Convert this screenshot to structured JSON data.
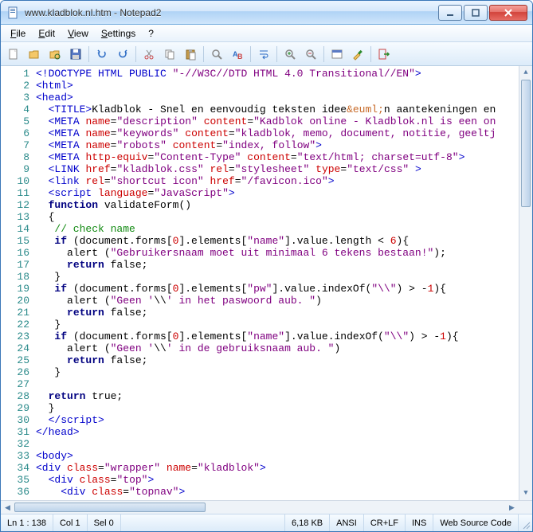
{
  "window": {
    "title": "www.kladblok.nl.htm - Notepad2"
  },
  "menu": {
    "file": "File",
    "edit": "Edit",
    "view": "View",
    "settings": "Settings",
    "help": "?"
  },
  "toolbar": {
    "new": "New",
    "open": "Open",
    "browse": "Browse",
    "save": "Save",
    "undo": "Undo",
    "redo": "Redo",
    "cut": "Cut",
    "copy": "Copy",
    "paste": "Paste",
    "find": "Find",
    "replace": "Replace",
    "wordwrap": "Word Wrap",
    "zoomin": "Zoom In",
    "zoomout": "Zoom Out",
    "scheme": "Scheme",
    "custom": "Customize",
    "exit": "Exit"
  },
  "code_lines": [
    {
      "n": 1,
      "html": "<span class='c-blue'>&lt;!DOCTYPE HTML PUBLIC </span><span class='c-purple'>\"-//W3C//DTD HTML 4.0 Transitional//EN\"</span><span class='c-blue'>&gt;</span>"
    },
    {
      "n": 2,
      "html": "<span class='c-blue'>&lt;html&gt;</span>"
    },
    {
      "n": 3,
      "html": "<span class='c-blue'>&lt;head&gt;</span>"
    },
    {
      "n": 4,
      "html": "  <span class='c-blue'>&lt;TITLE&gt;</span>Kladblok - Snel en eenvoudig teksten idee<span class='c-ent'>&amp;euml;</span>n aantekeningen en"
    },
    {
      "n": 5,
      "html": "  <span class='c-blue'>&lt;META</span> <span class='c-red'>name</span>=<span class='c-purple'>\"description\"</span> <span class='c-red'>content</span>=<span class='c-purple'>\"Kadblok online - Kladblok.nl is een on</span>"
    },
    {
      "n": 6,
      "html": "  <span class='c-blue'>&lt;META</span> <span class='c-red'>name</span>=<span class='c-purple'>\"keywords\"</span> <span class='c-red'>content</span>=<span class='c-purple'>\"kladblok, memo, document, notitie, geeltj</span>"
    },
    {
      "n": 7,
      "html": "  <span class='c-blue'>&lt;META</span> <span class='c-red'>name</span>=<span class='c-purple'>\"robots\"</span> <span class='c-red'>content</span>=<span class='c-purple'>\"index, follow\"</span><span class='c-blue'>&gt;</span>"
    },
    {
      "n": 8,
      "html": "  <span class='c-blue'>&lt;META</span> <span class='c-red'>http-equiv</span>=<span class='c-purple'>\"Content-Type\"</span> <span class='c-red'>content</span>=<span class='c-purple'>\"text/html; charset=utf-8\"</span><span class='c-blue'>&gt;</span>"
    },
    {
      "n": 9,
      "html": "  <span class='c-blue'>&lt;LINK</span> <span class='c-red'>href</span>=<span class='c-purple'>\"kladblok.css\"</span> <span class='c-red'>rel</span>=<span class='c-purple'>\"stylesheet\"</span> <span class='c-red'>type</span>=<span class='c-purple'>\"text/css\"</span> <span class='c-blue'>&gt;</span>"
    },
    {
      "n": 10,
      "html": "  <span class='c-blue'>&lt;link</span> <span class='c-red'>rel</span>=<span class='c-purple'>\"shortcut icon\"</span> <span class='c-red'>href</span>=<span class='c-purple'>\"/favicon.ico\"</span><span class='c-blue'>&gt;</span>"
    },
    {
      "n": 11,
      "html": "  <span class='c-blue'>&lt;script</span> <span class='c-red'>language</span>=<span class='c-purple'>\"JavaScript\"</span><span class='c-blue'>&gt;</span>"
    },
    {
      "n": 12,
      "html": "  <span class='c-navy'>function</span> validateForm()"
    },
    {
      "n": 13,
      "html": "  {"
    },
    {
      "n": 14,
      "html": "   <span class='c-str'>// check name</span>"
    },
    {
      "n": 15,
      "html": "   <span class='c-navy'>if</span> (document.forms[<span class='c-num'>0</span>].elements[<span class='c-purple'>\"name\"</span>].value.length &lt; <span class='c-num'>6</span>){"
    },
    {
      "n": 16,
      "html": "     alert (<span class='c-purple'>\"Gebruikersnaam moet uit minimaal 6 tekens bestaan!\"</span>);"
    },
    {
      "n": 17,
      "html": "     <span class='c-navy'>return</span> false;"
    },
    {
      "n": 18,
      "html": "   }"
    },
    {
      "n": 19,
      "html": "   <span class='c-navy'>if</span> (document.forms[<span class='c-num'>0</span>].elements[<span class='c-purple'>\"pw\"</span>].value.indexOf(<span class='c-purple'>\"\\\\\"</span>) &gt; -<span class='c-num'>1</span>){"
    },
    {
      "n": 20,
      "html": "     alert (<span class='c-purple'>\"Geen '</span>\\\\<span class='c-purple'>' in het paswoord aub. \"</span>)"
    },
    {
      "n": 21,
      "html": "     <span class='c-navy'>return</span> false;"
    },
    {
      "n": 22,
      "html": "   }"
    },
    {
      "n": 23,
      "html": "   <span class='c-navy'>if</span> (document.forms[<span class='c-num'>0</span>].elements[<span class='c-purple'>\"name\"</span>].value.indexOf(<span class='c-purple'>\"\\\\\"</span>) &gt; -<span class='c-num'>1</span>){"
    },
    {
      "n": 24,
      "html": "     alert (<span class='c-purple'>\"Geen '</span>\\\\<span class='c-purple'>' in de gebruiksnaam aub. \"</span>)"
    },
    {
      "n": 25,
      "html": "     <span class='c-navy'>return</span> false;"
    },
    {
      "n": 26,
      "html": "   }"
    },
    {
      "n": 27,
      "html": ""
    },
    {
      "n": 28,
      "html": "  <span class='c-navy'>return</span> true;"
    },
    {
      "n": 29,
      "html": "  }"
    },
    {
      "n": 30,
      "html": "  <span class='c-blue'>&lt;/script&gt;</span>"
    },
    {
      "n": 31,
      "html": "<span class='c-blue'>&lt;/head&gt;</span>"
    },
    {
      "n": 32,
      "html": ""
    },
    {
      "n": 33,
      "html": "<span class='c-blue'>&lt;body&gt;</span>"
    },
    {
      "n": 34,
      "html": "<span class='c-blue'>&lt;div</span> <span class='c-red'>class</span>=<span class='c-purple'>\"wrapper\"</span> <span class='c-red'>name</span>=<span class='c-purple'>\"kladblok\"</span><span class='c-blue'>&gt;</span>"
    },
    {
      "n": 35,
      "html": "  <span class='c-blue'>&lt;div</span> <span class='c-red'>class</span>=<span class='c-purple'>\"top\"</span><span class='c-blue'>&gt;</span>"
    },
    {
      "n": 36,
      "html": "    <span class='c-blue'>&lt;div</span> <span class='c-red'>class</span>=<span class='c-purple'>\"topnav\"</span><span class='c-blue'>&gt;</span>"
    }
  ],
  "status": {
    "pos": "Ln 1 : 138",
    "col": "Col 1",
    "sel": "Sel 0",
    "size": "6,18 KB",
    "enc": "ANSI",
    "eol": "CR+LF",
    "ovr": "INS",
    "scheme": "Web Source Code"
  }
}
